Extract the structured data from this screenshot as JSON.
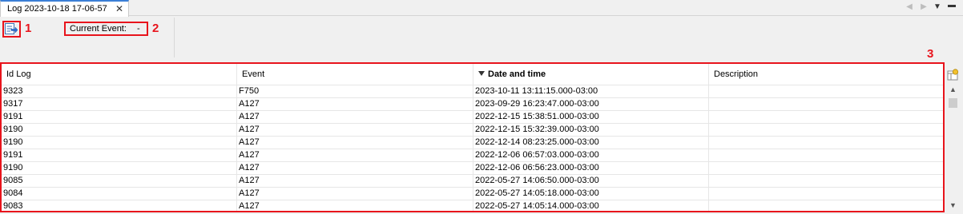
{
  "tab": {
    "title": "Log 2023-10-18 17-06-57",
    "close_glyph": "✕"
  },
  "tab_nav": {
    "prev_glyph": "◀",
    "next_glyph": "▶",
    "menu_glyph": "▼",
    "minimize_glyph": "▬"
  },
  "toolbar": {
    "export_icon": "export-icon",
    "current_event_label": "Current Event:",
    "current_event_value": "-"
  },
  "callouts": {
    "one": "1",
    "two": "2",
    "three": "3"
  },
  "grid": {
    "columns": [
      {
        "label": "Id Log",
        "sorted": false
      },
      {
        "label": "Event",
        "sorted": false
      },
      {
        "label": "Date and time",
        "sorted": true,
        "sort_direction": "descending"
      },
      {
        "label": "Description",
        "sorted": false
      }
    ],
    "rows": [
      [
        "9323",
        "F750",
        "2023-10-11 13:11:15.000-03:00",
        ""
      ],
      [
        "9317",
        "A127",
        "2023-09-29 16:23:47.000-03:00",
        ""
      ],
      [
        "9191",
        "A127",
        "2022-12-15 15:38:51.000-03:00",
        ""
      ],
      [
        "9190",
        "A127",
        "2022-12-15 15:32:39.000-03:00",
        ""
      ],
      [
        "9190",
        "A127",
        "2022-12-14 08:23:25.000-03:00",
        ""
      ],
      [
        "9191",
        "A127",
        "2022-12-06 06:57:03.000-03:00",
        ""
      ],
      [
        "9190",
        "A127",
        "2022-12-06 06:56:23.000-03:00",
        ""
      ],
      [
        "9085",
        "A127",
        "2022-05-27 14:06:50.000-03:00",
        ""
      ],
      [
        "9084",
        "A127",
        "2022-05-27 14:05:18.000-03:00",
        ""
      ],
      [
        "9083",
        "A127",
        "2022-05-27 14:05:14.000-03:00",
        ""
      ]
    ]
  },
  "scrollbar": {
    "up_glyph": "▲",
    "down_glyph": "▼"
  },
  "colors": {
    "callout_red": "#e8141c",
    "tab_accent": "#3b7fd6"
  }
}
